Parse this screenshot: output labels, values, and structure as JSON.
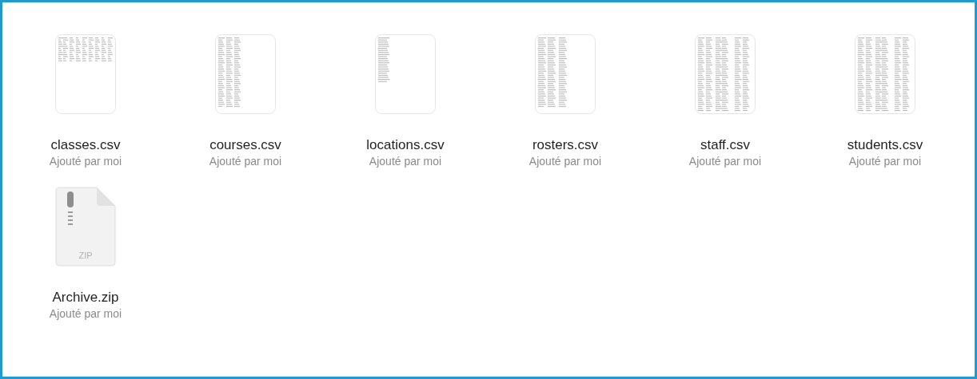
{
  "files": [
    {
      "kind": "csv",
      "name": "classes.csv",
      "subtitle": "Ajouté par moi"
    },
    {
      "kind": "csv",
      "name": "courses.csv",
      "subtitle": "Ajouté par moi"
    },
    {
      "kind": "csv",
      "name": "locations.csv",
      "subtitle": "Ajouté par moi"
    },
    {
      "kind": "csv",
      "name": "rosters.csv",
      "subtitle": "Ajouté par moi"
    },
    {
      "kind": "csv",
      "name": "staff.csv",
      "subtitle": "Ajouté par moi"
    },
    {
      "kind": "csv",
      "name": "students.csv",
      "subtitle": "Ajouté par moi"
    },
    {
      "kind": "zip",
      "name": "Archive.zip",
      "subtitle": "Ajouté par moi",
      "badge": "ZIP"
    }
  ]
}
